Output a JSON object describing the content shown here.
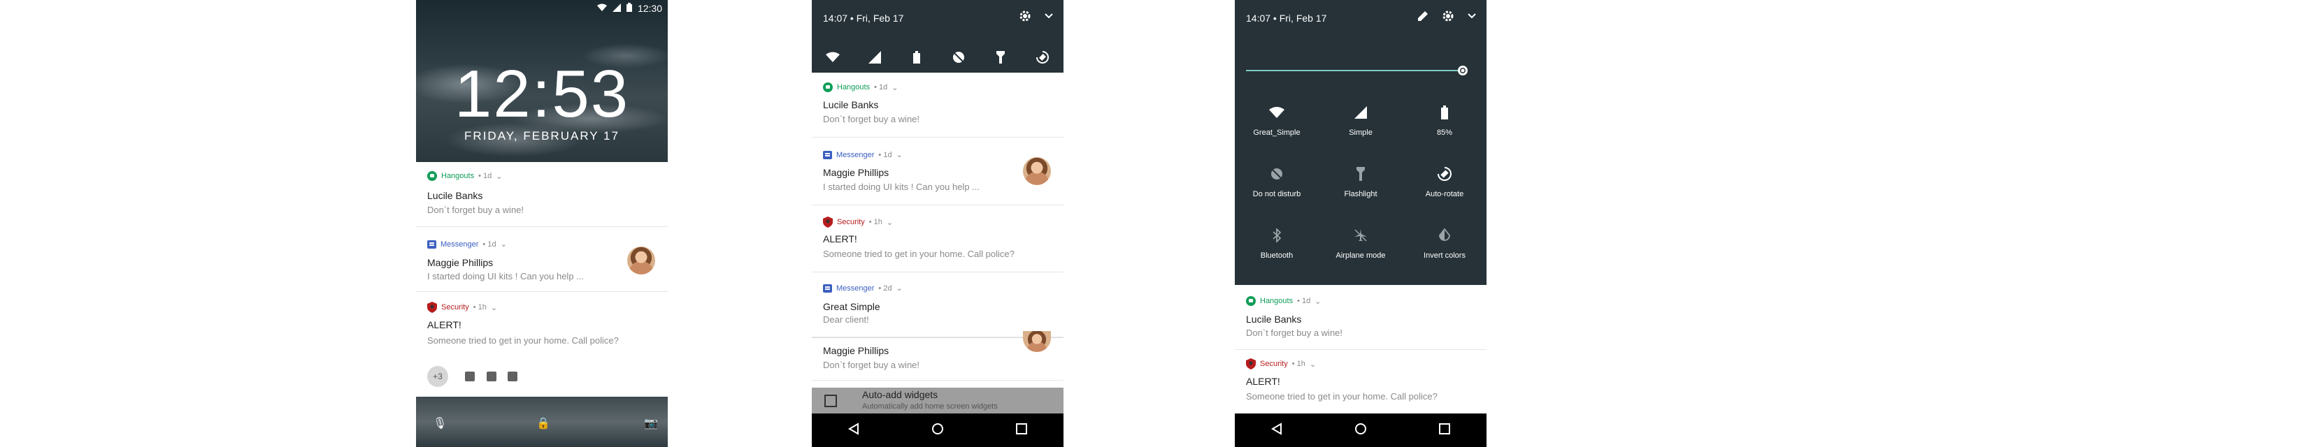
{
  "lock": {
    "status_time": "12:30",
    "clock": "12:53",
    "date": "FRIDAY, FEBRUARY 17",
    "notifications": [
      {
        "app": "Hangouts",
        "time": "• 1d",
        "title": "Lucile Banks",
        "body": "Don`t forget buy a wine!"
      },
      {
        "app": "Messenger",
        "time": "• 1d",
        "title": "Maggie Phillips",
        "body": "I started doing UI kits ! Can you help ..."
      },
      {
        "app": "Security",
        "time": "• 1h",
        "title": "ALERT!",
        "body": "Someone tried to get in your home. Call police?"
      }
    ],
    "more_count": "+3"
  },
  "shade_collapsed": {
    "datetime": "14:07 • Fri, Feb 17",
    "notifications": [
      {
        "app": "Hangouts",
        "time": "• 1d",
        "title": "Lucile Banks",
        "body": "Don`t forget buy a wine!"
      },
      {
        "app": "Messenger",
        "time": "• 1d",
        "title": "Maggie Phillips",
        "body": "I started doing UI kits ! Can you help ..."
      },
      {
        "app": "Security",
        "time": "• 1h",
        "title": "ALERT!",
        "body": "Someone tried to get in your home. Call police?"
      },
      {
        "app": "Messenger",
        "time": "• 2d",
        "title": "Great Simple",
        "body": "Dear client!"
      },
      {
        "app": "",
        "time": "",
        "title": "Maggie Phillips",
        "body": "Don`t forget buy a wine!"
      }
    ],
    "setting_title": "Auto-add widgets",
    "setting_sub": "Automatically add home screen widgets"
  },
  "shade_expanded": {
    "datetime": "14:07 • Fri, Feb 17",
    "brightness": 1.0,
    "tiles": [
      {
        "label": "Great_Simple",
        "icon": "wifi-icon"
      },
      {
        "label": "Simple",
        "icon": "signal-icon"
      },
      {
        "label": "85%",
        "icon": "battery-icon"
      },
      {
        "label": "Do not disturb",
        "icon": "dnd-icon"
      },
      {
        "label": "Flashlight",
        "icon": "flashlight-icon"
      },
      {
        "label": "Auto-rotate",
        "icon": "rotate-icon"
      },
      {
        "label": "Bluetooth",
        "icon": "bluetooth-icon"
      },
      {
        "label": "Airplane mode",
        "icon": "airplane-icon"
      },
      {
        "label": "Invert colors",
        "icon": "invert-icon"
      }
    ],
    "notifications": [
      {
        "app": "Hangouts",
        "time": "• 1d",
        "title": "Lucile Banks",
        "body": "Don`t forget buy a wine!"
      },
      {
        "app": "Security",
        "time": "• 1h",
        "title": "ALERT!",
        "body": "Someone tried to get in your home. Call police?"
      }
    ]
  },
  "colors": {
    "hangouts": "#0f9d58",
    "messenger": "#3b5fc0",
    "security": "#b71c1c",
    "shade": "#263238",
    "accent": "#80cbc4"
  }
}
